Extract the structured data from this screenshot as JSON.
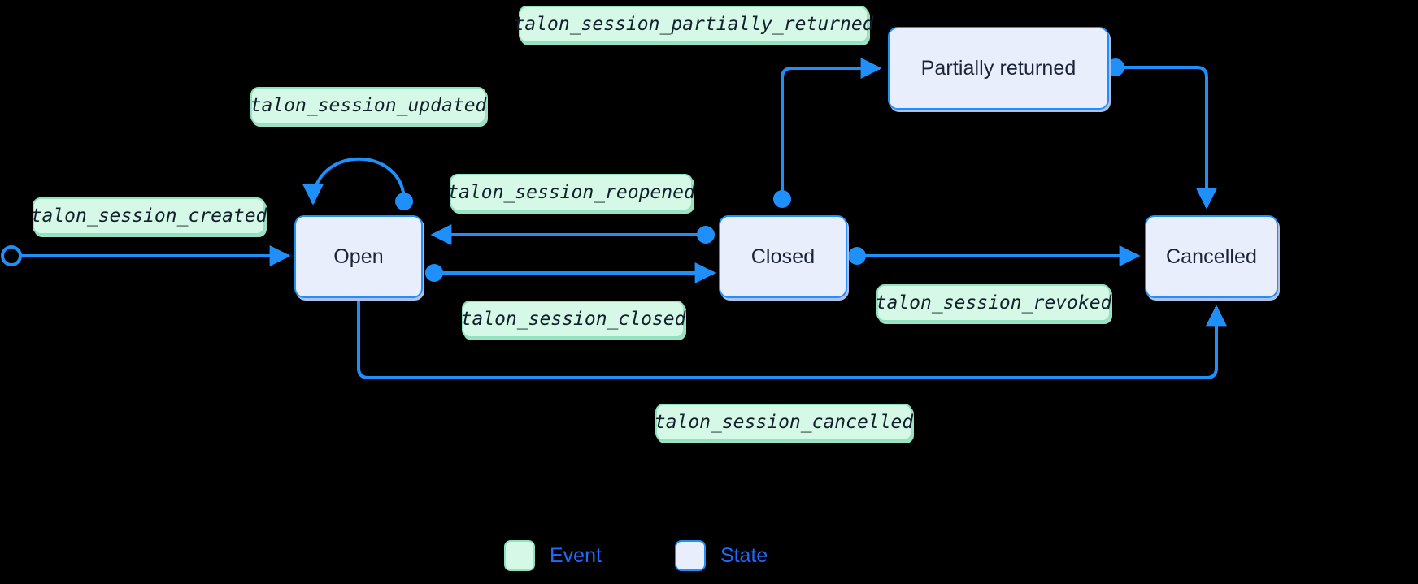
{
  "diagram": {
    "type": "state-machine",
    "title": "",
    "background_color": "#000000",
    "accent_color": "#1f8ffa",
    "event_fill": "#d6f8e6",
    "event_border": "#8fe3c0",
    "state_fill": "#e8eefc",
    "state_border": "#1f8ffa",
    "states": [
      {
        "id": "open",
        "label": "Open"
      },
      {
        "id": "closed",
        "label": "Closed"
      },
      {
        "id": "partially_returned",
        "label": "Partially returned"
      },
      {
        "id": "cancelled",
        "label": "Cancelled"
      }
    ],
    "start_node": {
      "label": "",
      "shape": "circle-outline"
    },
    "events": [
      {
        "id": "created",
        "label": "talon_session_created",
        "from": "start",
        "to": "open"
      },
      {
        "id": "updated",
        "label": "talon_session_updated",
        "from": "open",
        "to": "open"
      },
      {
        "id": "reopened",
        "label": "talon_session_reopened",
        "from": "closed",
        "to": "open"
      },
      {
        "id": "closed",
        "label": "talon_session_closed",
        "from": "open",
        "to": "closed"
      },
      {
        "id": "partially_returned",
        "label": "talon_session_partially_returned",
        "from": "closed",
        "to": "partially_returned"
      },
      {
        "id": "revoked",
        "label": "talon_session_revoked",
        "from": "closed",
        "to": "cancelled"
      },
      {
        "id": "cancelled",
        "label": "talon_session_cancelled",
        "from": "open",
        "to": "cancelled"
      }
    ],
    "legend": [
      {
        "id": "event",
        "label": "Event",
        "swatch": "event"
      },
      {
        "id": "state",
        "label": "State",
        "swatch": "state"
      }
    ]
  }
}
